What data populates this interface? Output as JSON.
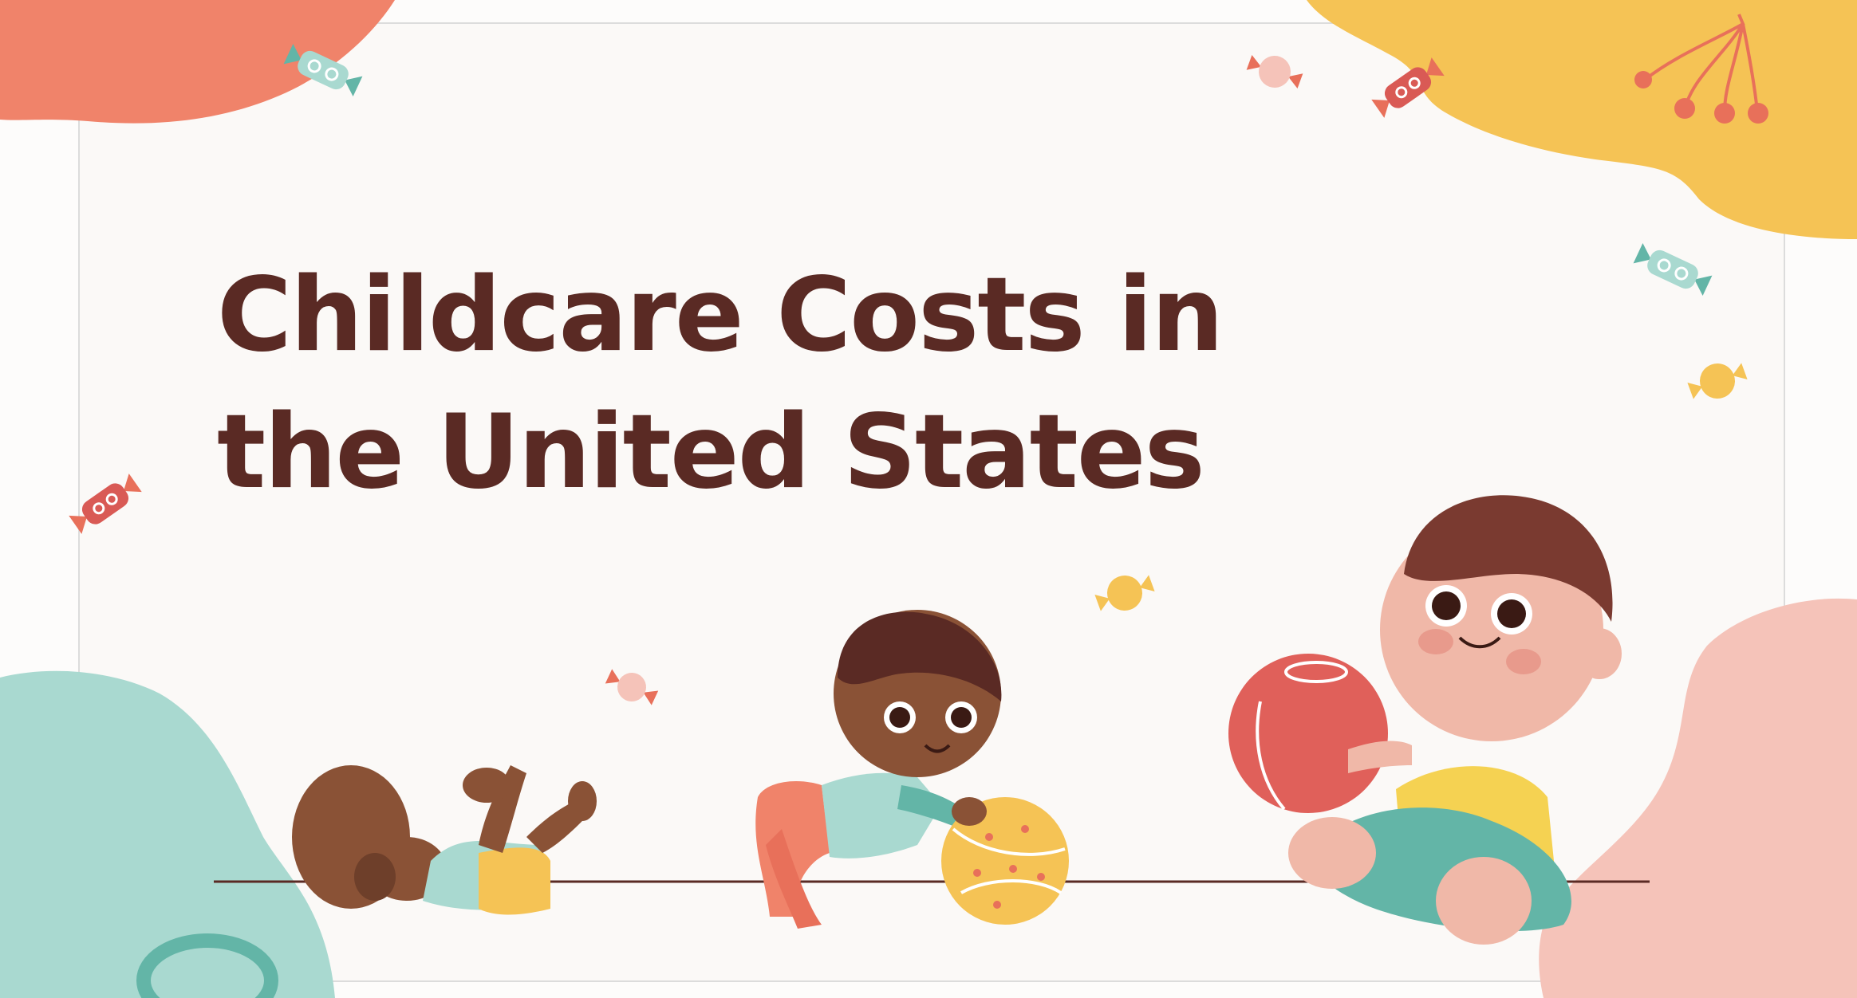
{
  "title": {
    "line1": "Childcare Costs in",
    "line2": "the United States"
  },
  "colors": {
    "title_text": "#5a2a24",
    "background": "#fbf9f7",
    "blob_coral": "#f0836a",
    "blob_yellow": "#f5c355",
    "blob_teal": "#a9d9d0",
    "blob_pink": "#f5c3b9",
    "ground_line": "#5a2a24"
  },
  "decorations": [
    "candy-icon",
    "cherry-icon",
    "crawling-baby",
    "toddler-with-ball",
    "sitting-baby-with-ball",
    "yellow-star-ball",
    "red-ball"
  ]
}
